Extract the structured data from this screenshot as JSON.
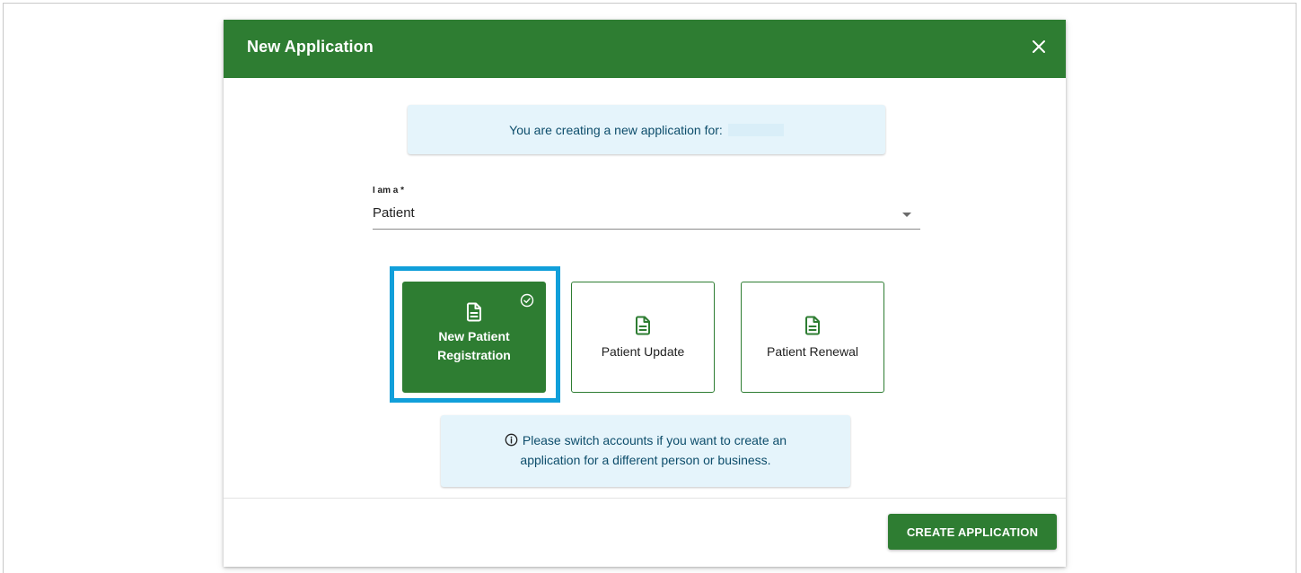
{
  "dialog": {
    "title": "New Application",
    "close_icon": "close-icon"
  },
  "banner": {
    "text": "You are creating a new application for:"
  },
  "role_select": {
    "label": "I am a *",
    "value": "Patient"
  },
  "options": [
    {
      "label": "New Patient Registration",
      "icon": "document-icon",
      "selected": true
    },
    {
      "label": "Patient Update",
      "icon": "document-icon",
      "selected": false
    },
    {
      "label": "Patient Renewal",
      "icon": "document-icon",
      "selected": false
    }
  ],
  "notice": {
    "line1": "Please switch accounts if you want to create an",
    "line2": "application for a different person or business.",
    "icon": "info-icon"
  },
  "footer": {
    "create_label": "CREATE APPLICATION"
  },
  "colors": {
    "primary_green": "#2e7d32",
    "info_background": "#e5f4fb",
    "info_text": "#0d4d6b",
    "highlight_blue": "#119fda"
  }
}
